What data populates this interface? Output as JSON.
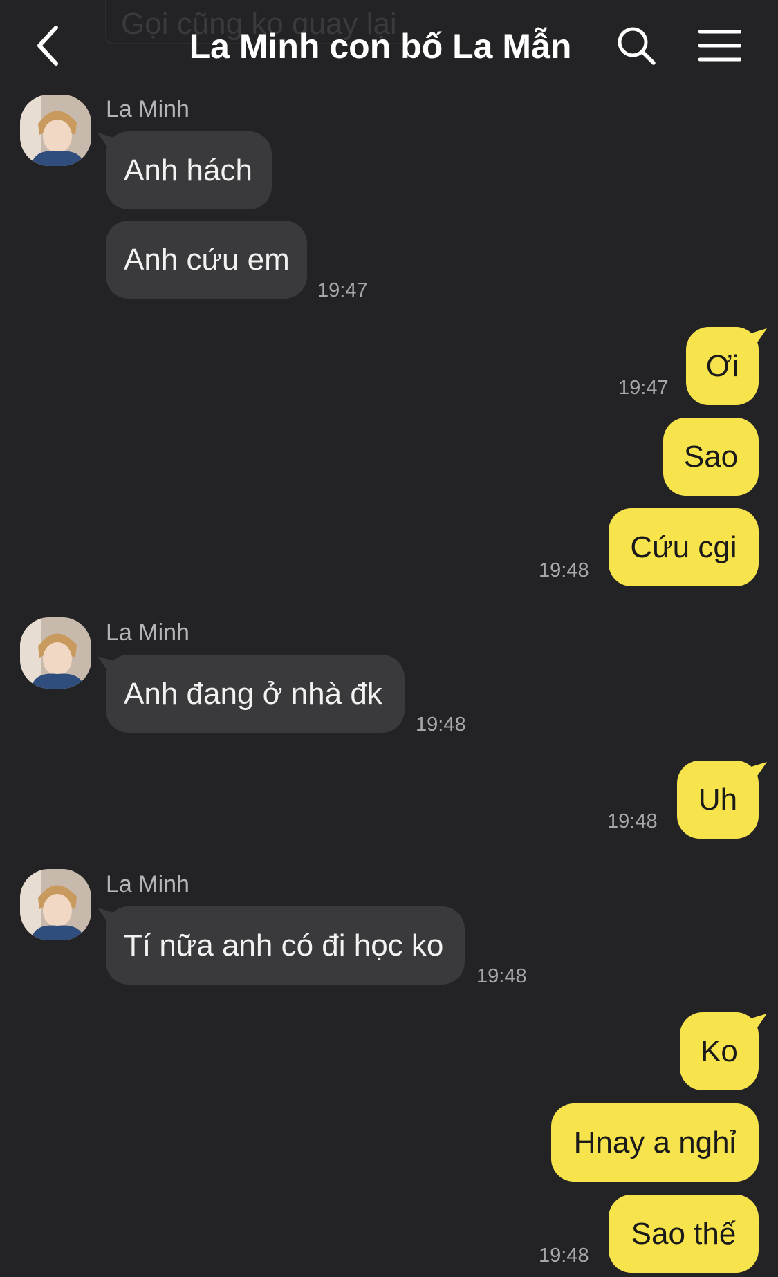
{
  "header": {
    "title": "La Minh con bố La Mẫn",
    "ghost_text": "Gọi cũng ko quay lại",
    "back_icon": "chevron-left-icon",
    "search_icon": "search-icon",
    "menu_icon": "hamburger-menu-icon"
  },
  "colors": {
    "background": "#232325",
    "incoming_bubble": "#3a3a3c",
    "outgoing_bubble": "#f7e34b"
  },
  "messages": [
    {
      "sender": "La Minh",
      "text": "Anh hách",
      "time": ""
    },
    {
      "sender": "La Minh",
      "text": "Anh cứu em",
      "time": "19:47"
    },
    {
      "sender": "me",
      "text": "Ơi",
      "time": "19:47"
    },
    {
      "sender": "me",
      "text": "Sao",
      "time": ""
    },
    {
      "sender": "me",
      "text": "Cứu cgi",
      "time": "19:48"
    },
    {
      "sender": "La Minh",
      "text": "Anh đang ở nhà đk",
      "time": "19:48"
    },
    {
      "sender": "me",
      "text": "Uh",
      "time": "19:48"
    },
    {
      "sender": "La Minh",
      "text": "Tí nữa anh có đi học ko",
      "time": "19:48"
    },
    {
      "sender": "me",
      "text": "Ko",
      "time": ""
    },
    {
      "sender": "me",
      "text": "Hnay a nghỉ",
      "time": ""
    },
    {
      "sender": "me",
      "text": "Sao thế",
      "time": "19:48"
    }
  ]
}
